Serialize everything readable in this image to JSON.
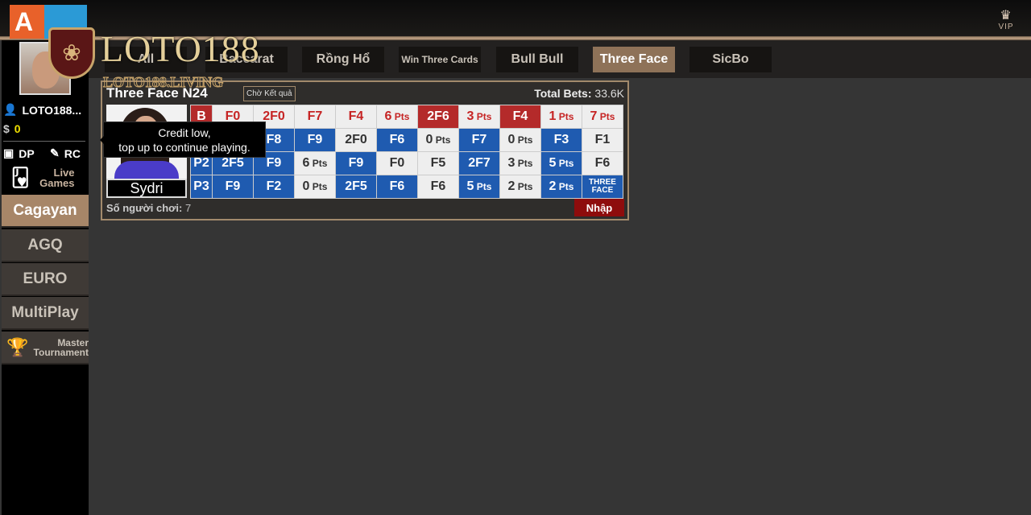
{
  "header": {
    "vip_label": "VIP",
    "logo_text": "LOTO188",
    "logo_sub": "LOTO188.LIVING",
    "ag_logo": "AG"
  },
  "tabs": [
    {
      "label": "All",
      "active": false
    },
    {
      "label": "Baccarat",
      "active": false
    },
    {
      "label": "Rồng Hổ",
      "active": false
    },
    {
      "label": "Win Three Cards",
      "active": false
    },
    {
      "label": "Bull Bull",
      "active": false
    },
    {
      "label": "Three Face",
      "active": true
    },
    {
      "label": "SicBo",
      "active": false
    }
  ],
  "user": {
    "name": "LOTO188...",
    "balance": "0",
    "dp_label": "DP",
    "rc_label": "RC",
    "live_games_label": "Live Games"
  },
  "sidebar": {
    "items": [
      {
        "label": "Cagayan",
        "active": true
      },
      {
        "label": "AGQ",
        "active": false
      },
      {
        "label": "EURO",
        "active": false
      },
      {
        "label": "MultiPlay",
        "active": false
      },
      {
        "label": "Master Tournament",
        "active": false
      }
    ]
  },
  "table_card": {
    "title": "Three Face N24",
    "status": "Chờ Kết quả",
    "total_bets_label": "Total Bets:",
    "total_bets_value": "33.6K",
    "dealer_name": "Sydri",
    "players_label": "Số người chơi:",
    "players_count": "7",
    "enter_label": "Nhập",
    "rows": [
      [
        [
          "B",
          "r"
        ],
        [
          "F0",
          "wr"
        ],
        [
          "2F0",
          "wr"
        ],
        [
          "F7",
          "wr"
        ],
        [
          "F4",
          "wr"
        ],
        [
          "6 Pts",
          "wr"
        ],
        [
          "2F6",
          "r"
        ],
        [
          "3 Pts",
          "wr"
        ],
        [
          "F4",
          "r"
        ],
        [
          "1 Pts",
          "wr"
        ],
        [
          "7 Pts",
          "wr"
        ]
      ],
      [
        [
          "",
          "b"
        ],
        [
          "",
          "w"
        ],
        [
          "F8",
          "b"
        ],
        [
          "F9",
          "b"
        ],
        [
          "2F0",
          "w"
        ],
        [
          "F6",
          "b"
        ],
        [
          "0 Pts",
          "w"
        ],
        [
          "F7",
          "b"
        ],
        [
          "0 Pts",
          "w"
        ],
        [
          "F3",
          "b"
        ],
        [
          "F1",
          "w"
        ]
      ],
      [
        [
          "P2",
          "b"
        ],
        [
          "2F5",
          "b"
        ],
        [
          "F9",
          "b"
        ],
        [
          "6 Pts",
          "w"
        ],
        [
          "F9",
          "b"
        ],
        [
          "F0",
          "w"
        ],
        [
          "F5",
          "w"
        ],
        [
          "2F7",
          "b"
        ],
        [
          "3 Pts",
          "w"
        ],
        [
          "5 Pts",
          "b"
        ],
        [
          "F6",
          "w"
        ]
      ],
      [
        [
          "P3",
          "b"
        ],
        [
          "F9",
          "b"
        ],
        [
          "F2",
          "b"
        ],
        [
          "0 Pts",
          "w"
        ],
        [
          "2F5",
          "b"
        ],
        [
          "F6",
          "b"
        ],
        [
          "F6",
          "w"
        ],
        [
          "5 Pts",
          "b"
        ],
        [
          "2 Pts",
          "w"
        ],
        [
          "2 Pts",
          "b"
        ],
        [
          "THREE FACE",
          "b"
        ]
      ]
    ]
  },
  "tooltip": {
    "line1": "Credit low,",
    "line2": "top up to continue playing."
  }
}
